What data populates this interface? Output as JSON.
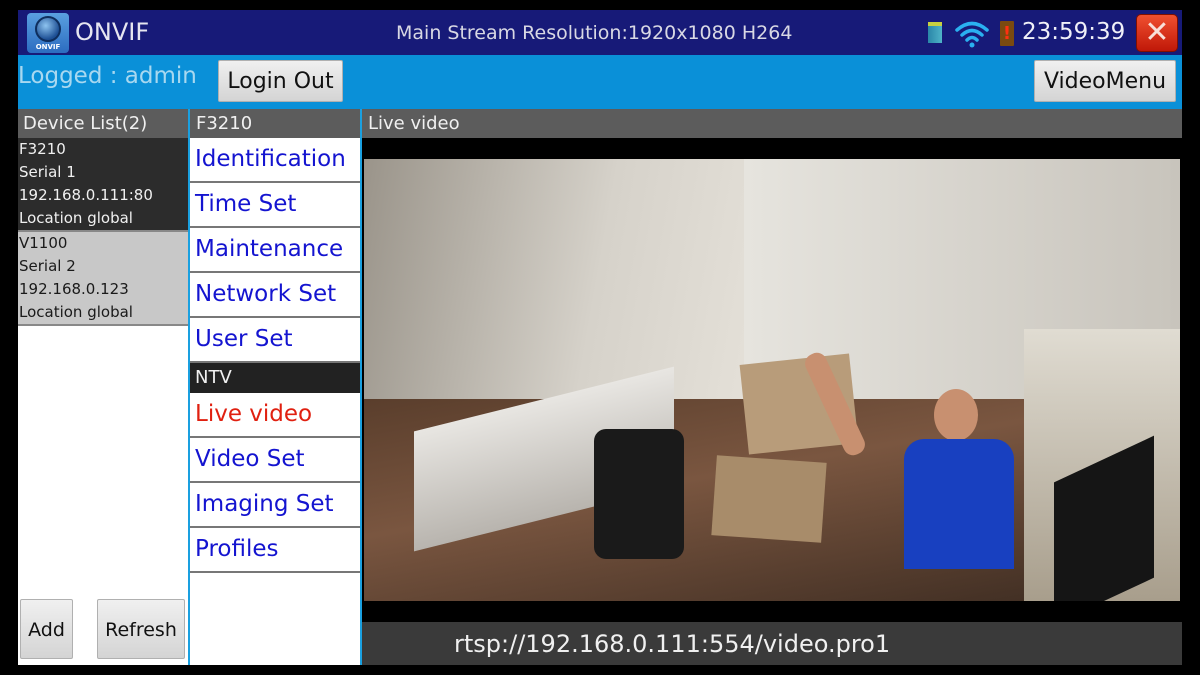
{
  "titlebar": {
    "logo_text": "ONVIF",
    "app_title": "ONVIF",
    "stream_resolution": "Main Stream Resolution:1920x1080 H264",
    "clock": "23:59:39",
    "close_glyph": "✕",
    "battery_glyph": "!",
    "icons": [
      "sd-card-icon",
      "wifi-icon",
      "battery-low-icon",
      "close-icon"
    ]
  },
  "toolbar": {
    "logged_text": "Logged : admin",
    "login_out_label": "Login Out",
    "video_menu_label": "VideoMenu"
  },
  "device_panel": {
    "header": "Device List(2)",
    "devices": [
      {
        "name": "F3210",
        "serial": "Serial 1",
        "address": "192.168.0.111:80",
        "location": "Location global",
        "selected": true
      },
      {
        "name": "V1100",
        "serial": "Serial 2",
        "address": "192.168.0.123",
        "location": "Location global",
        "selected": false
      }
    ],
    "add_label": "Add",
    "refresh_label": "Refresh"
  },
  "menu_panel": {
    "header": "F3210",
    "items": [
      "Identification",
      "Time Set",
      "Maintenance",
      "Network Set",
      "User Set"
    ],
    "section": "NTV",
    "ntv_items": [
      "Live video",
      "Video Set",
      "Imaging Set",
      "Profiles"
    ],
    "active_item": "Live video"
  },
  "video_panel": {
    "header": "Live video",
    "rtsp_url": "rtsp://192.168.0.111:554/video.pro1"
  },
  "colors": {
    "titlebar_bg": "#171a78",
    "toolbar_bg": "#0a90d8",
    "menu_link": "#1414d0",
    "menu_active": "#e02010",
    "close_button": "#e03a20"
  }
}
